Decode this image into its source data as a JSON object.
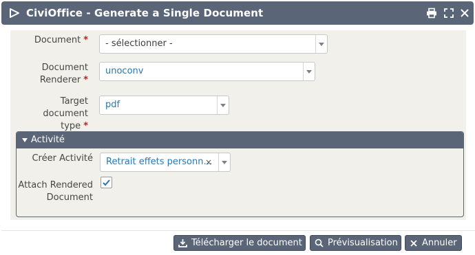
{
  "dialog": {
    "title": "CiviOffice - Generate a Single Document",
    "toolbar_icons": [
      "print-icon",
      "maximize-icon",
      "close-icon"
    ]
  },
  "form": {
    "required_marker": "*",
    "document": {
      "label": "Document",
      "value": "- sélectionner -"
    },
    "renderer": {
      "label_line1": "Document",
      "label_line2": "Renderer",
      "value": "unoconv"
    },
    "target_type": {
      "label_line1": "Target document",
      "label_line2": "type",
      "value": "pdf"
    }
  },
  "activity": {
    "section_title": "Activité",
    "create": {
      "label": "Créer Activité",
      "value": "Retrait effets personn…",
      "clear": "×"
    },
    "attach": {
      "label_line1": "Attach Rendered",
      "label_line2": "Document",
      "checked": true
    }
  },
  "buttons": {
    "download": "Télécharger le document",
    "preview": "Prévisualisation",
    "cancel": "Annuler"
  },
  "colors": {
    "header": "#5a6578",
    "panel": "#f1f0ea",
    "required": "#a52a2a",
    "link_value": "#2678b5"
  }
}
